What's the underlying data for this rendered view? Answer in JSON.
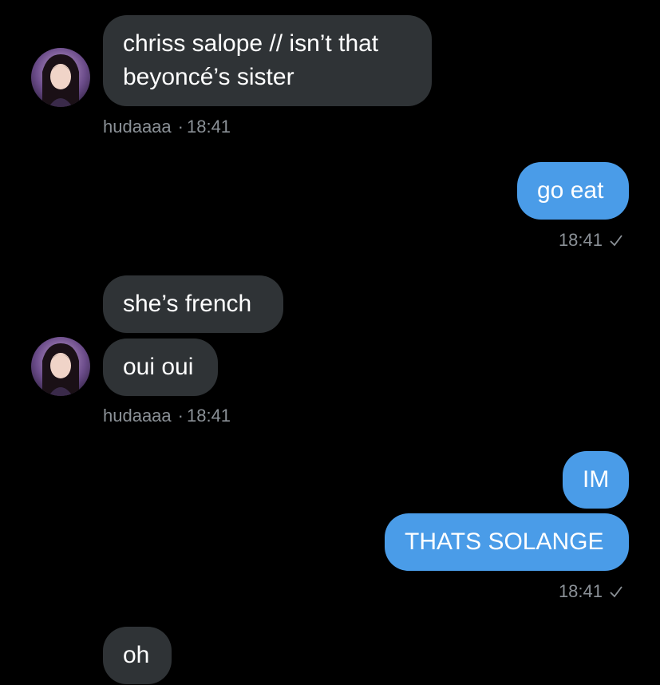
{
  "colors": {
    "background": "#000000",
    "incoming_bubble": "#2f3336",
    "outgoing_bubble": "#4a9ce8",
    "meta_text": "#8b9197"
  },
  "messages": [
    {
      "direction": "incoming",
      "text": "chriss salope // isn’t that beyoncé’s sister"
    },
    {
      "direction": "outgoing",
      "text": "go eat"
    },
    {
      "direction": "incoming",
      "text": "she’s french"
    },
    {
      "direction": "incoming",
      "text": "oui oui"
    },
    {
      "direction": "outgoing",
      "text": "IM"
    },
    {
      "direction": "outgoing",
      "text": "THATS SOLANGE"
    },
    {
      "direction": "incoming",
      "text": "oh"
    }
  ],
  "msg1_line1": "chriss salope // isn’t that",
  "msg1_line2": "beyoncé’s sister",
  "meta_in_1": {
    "sender": "hudaaaa",
    "separator": "·",
    "time": "18:41"
  },
  "meta_out_1": {
    "time": "18:41",
    "status_icon": "sent-check-icon"
  },
  "meta_in_2": {
    "sender": "hudaaaa",
    "separator": "·",
    "time": "18:41"
  },
  "meta_out_2": {
    "time": "18:41",
    "status_icon": "sent-check-icon"
  }
}
